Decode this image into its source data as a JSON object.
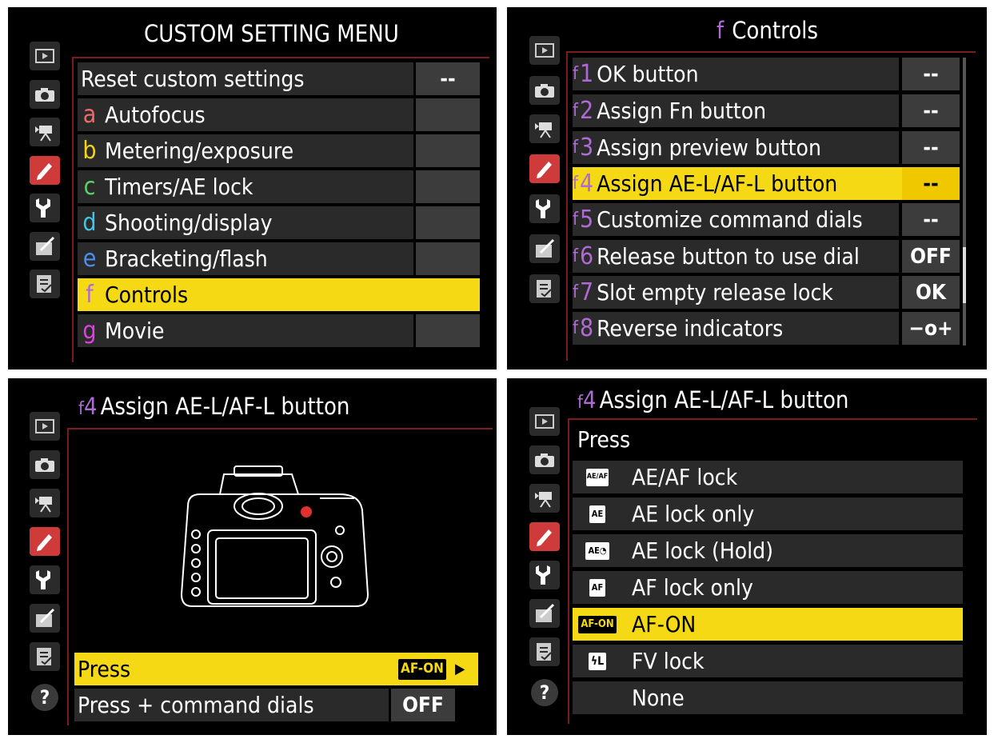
{
  "panel1": {
    "title": "CUSTOM SETTING MENU",
    "items": [
      {
        "letter": "",
        "label": "Reset custom settings",
        "value": "--"
      },
      {
        "letter": "a",
        "label": "Autofocus",
        "value": "",
        "color": "#f06a6a"
      },
      {
        "letter": "b",
        "label": "Metering/exposure",
        "value": "",
        "color": "#f2d21a"
      },
      {
        "letter": "c",
        "label": "Timers/AE lock",
        "value": "",
        "color": "#5cd06a"
      },
      {
        "letter": "d",
        "label": "Shooting/display",
        "value": "",
        "color": "#3cc8e6"
      },
      {
        "letter": "e",
        "label": "Bracketing/flash",
        "value": "",
        "color": "#4a8ef0"
      },
      {
        "letter": "f",
        "label": "Controls",
        "value": "",
        "color": "#b06ad6"
      },
      {
        "letter": "g",
        "label": "Movie",
        "value": "",
        "color": "#e040e0"
      }
    ]
  },
  "panel2": {
    "title_prefix": "f",
    "title": "Controls",
    "items": [
      {
        "num": "1",
        "label": "OK button",
        "value": "--"
      },
      {
        "num": "2",
        "label": "Assign Fn button",
        "value": "--"
      },
      {
        "num": "3",
        "label": "Assign preview button",
        "value": "--"
      },
      {
        "num": "4",
        "label": "Assign AE-L/AF-L button",
        "value": "--"
      },
      {
        "num": "5",
        "label": "Customize command dials",
        "value": "--"
      },
      {
        "num": "6",
        "label": "Release button to use dial",
        "value": "OFF"
      },
      {
        "num": "7",
        "label": "Slot empty release lock",
        "value": "OK"
      },
      {
        "num": "8",
        "label": "Reverse indicators",
        "value": "−o+"
      }
    ]
  },
  "panel3": {
    "title_num": "4",
    "title": "Assign AE-L/AF-L button",
    "items": [
      {
        "label": "Press",
        "value": "AF-ON",
        "arrow": "▶"
      },
      {
        "label": "Press + command dials",
        "value": "OFF"
      }
    ]
  },
  "panel4": {
    "title_num": "4",
    "title": "Assign AE-L/AF-L button",
    "subtitle": "Press",
    "items": [
      {
        "icon": "AE/AF",
        "label": "AE/AF lock"
      },
      {
        "icon": "AE",
        "label": "AE lock only"
      },
      {
        "icon": "AE◔",
        "label": "AE lock (Hold)"
      },
      {
        "icon": "AF",
        "label": "AF lock only"
      },
      {
        "icon": "AF-ON",
        "label": "AF-ON"
      },
      {
        "icon": "ϟL",
        "label": "FV lock"
      },
      {
        "icon": "",
        "label": "None"
      }
    ]
  },
  "tabs": [
    "playback-menu-icon",
    "camera-menu-icon",
    "movie-menu-icon",
    "pencil-icon",
    "wrench-icon",
    "retouch-icon",
    "my-menu-icon",
    "help-icon"
  ],
  "help_label": "?",
  "colors": {
    "highlight": "#f5d914",
    "active_tab": "#cf3b3b",
    "f_purple": "#b06ad6"
  }
}
